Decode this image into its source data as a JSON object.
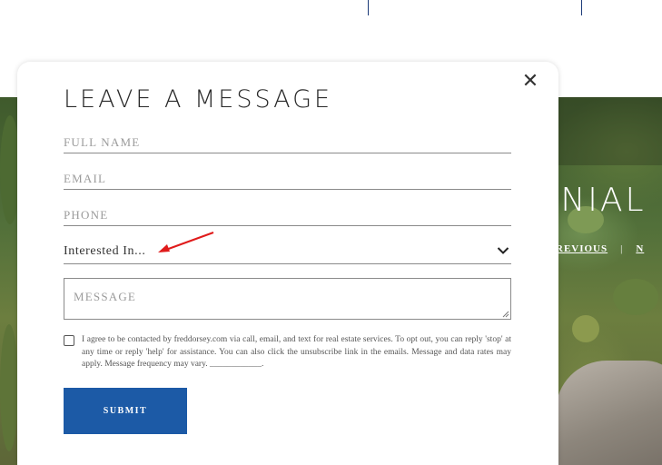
{
  "hero": {
    "title": "ONIAL",
    "nav": {
      "previous_label": "REVIOUS",
      "separator": "|",
      "next_label": "N"
    }
  },
  "modal": {
    "title": "LEAVE A MESSAGE",
    "close_icon": "close-icon",
    "fields": {
      "full_name_placeholder": "FULL NAME",
      "email_placeholder": "EMAIL",
      "phone_placeholder": "PHONE"
    },
    "interest_select": {
      "selected": "Interested In...",
      "icon": "chevron-down-icon"
    },
    "message_placeholder": "MESSAGE",
    "consent_text": "I agree to be contacted by freddorsey.com via call, email, and text for real estate services. To opt out, you can reply 'stop' at any time or reply 'help' for assistance. You can also click the unsubscribe link in the emails. Message and data rates may apply. Message frequency may vary. ____________.",
    "submit_label": "SUBMIT"
  },
  "colors": {
    "submit_bg": "#1c5aa6",
    "annotation_arrow": "#e01b1b",
    "header_divider": "#1b3a78"
  }
}
